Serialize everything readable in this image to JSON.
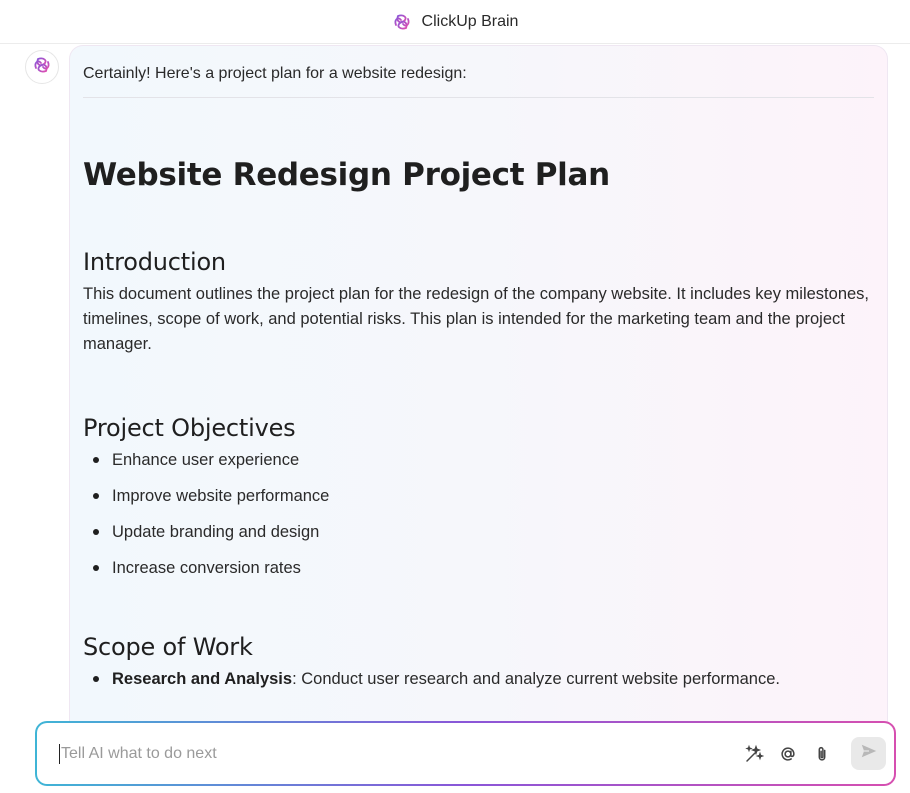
{
  "header": {
    "title": "ClickUp Brain"
  },
  "message": {
    "intro": "Certainly! Here's a project plan for a website redesign:",
    "doc_title": "Website Redesign Project Plan",
    "introduction": {
      "heading": "Introduction",
      "text": "This document outlines the project plan for the redesign of the company website. It includes key milestones, timelines, scope of work, and potential risks. This plan is intended for the marketing team and the project manager."
    },
    "objectives": {
      "heading": "Project Objectives",
      "items": [
        "Enhance user experience",
        "Improve website performance",
        "Update branding and design",
        "Increase conversion rates"
      ]
    },
    "scope": {
      "heading": "Scope of Work",
      "items": [
        {
          "title": "Research and Analysis",
          "text": ": Conduct user research and analyze current website performance."
        }
      ]
    }
  },
  "composer": {
    "placeholder": "Tell AI what to do next",
    "icons": [
      "sparkle-wand-icon",
      "at-mention-icon",
      "paperclip-icon",
      "send-icon"
    ]
  },
  "colors": {
    "brand_gradient": [
      "#3fb5d6",
      "#8a56d8",
      "#d64fb0"
    ],
    "logo": "#c23bd4"
  }
}
